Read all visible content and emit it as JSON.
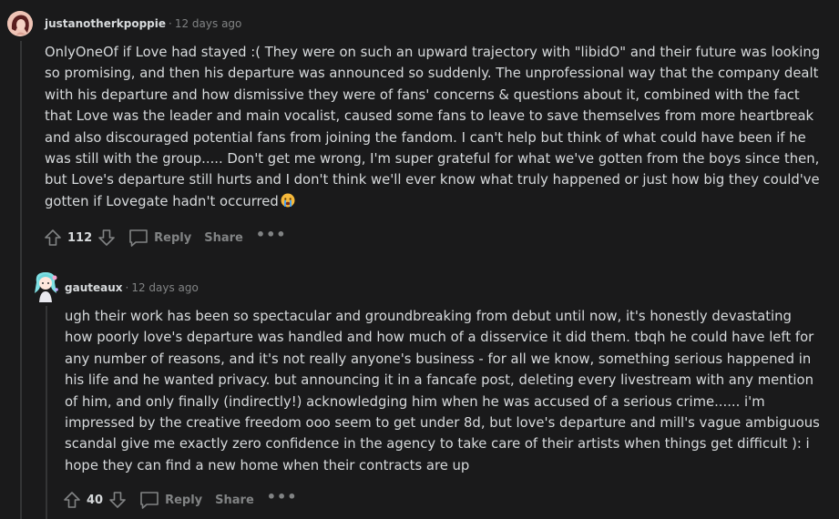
{
  "comments": [
    {
      "author": "justanotherkpoppie",
      "separator": "·",
      "time": "12 days ago",
      "lines": [
        "OnlyOneOf if Love had stayed :( They were on such an upward trajectory with \"libidO\" and their future was looking",
        "so promising, and then his departure was announced so suddenly. The unprofessional way that the company dealt",
        "with his departure and how dismissive they were of fans' concerns & questions about it, combined with the fact",
        "that Love was the leader and main vocalist, caused some fans to leave to save themselves from more heartbreak",
        "and also discouraged potential fans from joining the fandom. I can't help but think of what could have been if he",
        "was still with the group..... Don't get me wrong, I'm super grateful for what we've gotten from the boys since then,",
        "but Love's departure still hurts and I don't think we'll ever know what truly happened or just how big they could've",
        "gotten if Lovegate hadn't occurred"
      ],
      "emoji": "crying-face-emoji",
      "votes": "112",
      "reply_label": "Reply",
      "share_label": "Share",
      "more_label": "•••"
    },
    {
      "author": "gauteaux",
      "separator": "·",
      "time": "12 days ago",
      "lines": [
        "ugh their work has been so spectacular and groundbreaking from debut until now, it's honestly devastating",
        "how poorly love's departure was handled and how much of a disservice it did them. tbqh he could have left for",
        "any number of reasons, and it's not really anyone's business - for all we know, something serious happened in",
        "his life and he wanted privacy. but announcing it in a fancafe post, deleting every livestream with any mention",
        "of him, and only finally (indirectly!) acknowledging him when he was accused of a serious crime...... i'm",
        "impressed by the creative freedom ooo seem to get under 8d, but love's departure and mill's vague ambiguous",
        "scandal give me exactly zero confidence in the agency to take care of their artists when things get difficult ): i",
        "hope they can find a new home when their contracts are up"
      ],
      "votes": "40",
      "reply_label": "Reply",
      "share_label": "Share",
      "more_label": "•••"
    }
  ],
  "colors": {
    "background": "#1a1a1b",
    "text": "#d7dadc",
    "muted": "#818384",
    "thread_line": "#343536"
  }
}
